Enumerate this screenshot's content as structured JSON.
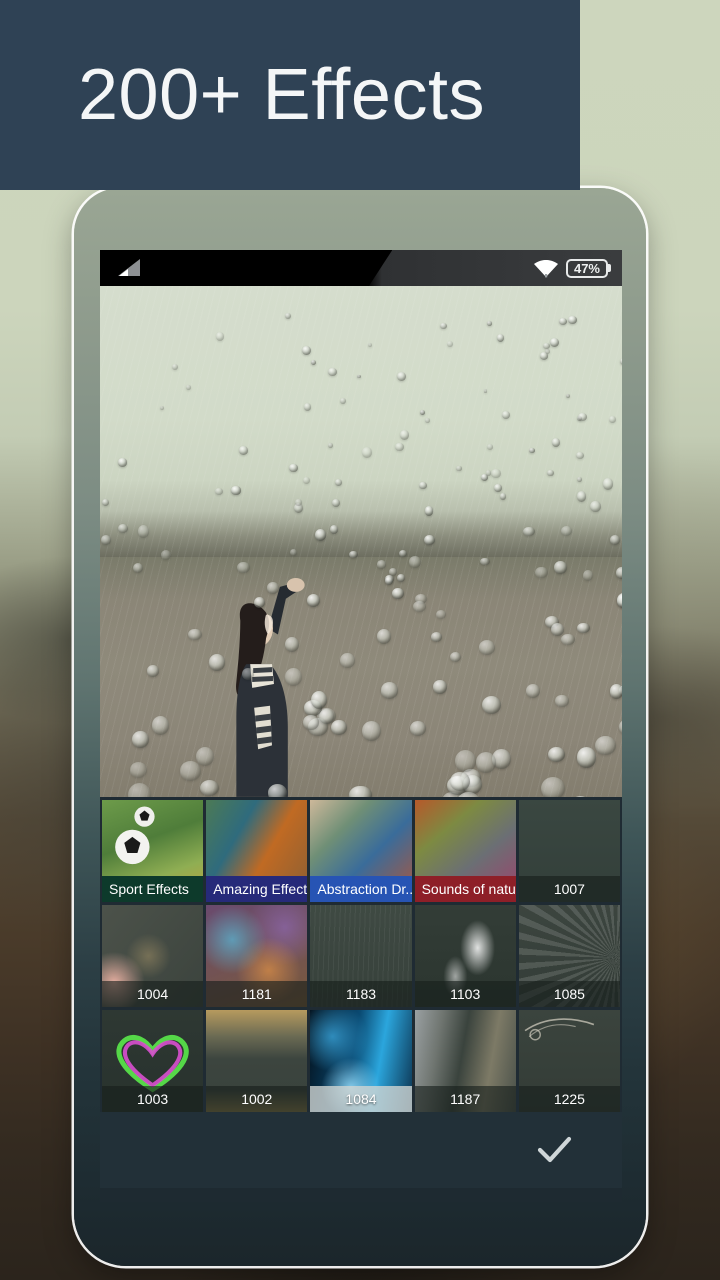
{
  "banner": {
    "title": "200+  Effects",
    "bg_color": "#2f4255",
    "text_color": "#f4f6f7"
  },
  "statusbar": {
    "signal_icon": "cell-signal-icon",
    "wifi_icon": "wifi-icon",
    "battery_level": "47%",
    "battery_icon": "battery-icon"
  },
  "photo": {
    "description": "Woman in striped scarf standing in a rainy field with water-droplet overlay effect",
    "alt": "edited-photo-preview"
  },
  "grid": {
    "columns": 5,
    "rows": 3,
    "items": [
      {
        "label": "Sport Effects",
        "type": "pack",
        "cap_color": "#0d3a2b",
        "selected": false
      },
      {
        "label": "Amazing Effects",
        "type": "pack",
        "cap_color": "#262a7a",
        "selected": false
      },
      {
        "label": "Abstraction Dr...",
        "type": "pack",
        "cap_color": "#2754b4",
        "selected": false
      },
      {
        "label": "Sounds of natu...",
        "type": "pack",
        "cap_color": "#8e1f28",
        "selected": false
      },
      {
        "label": "1007",
        "type": "effect",
        "cap_color": "",
        "selected": false
      },
      {
        "label": "1004",
        "type": "effect",
        "cap_color": "",
        "selected": false
      },
      {
        "label": "1181",
        "type": "effect",
        "cap_color": "",
        "selected": false
      },
      {
        "label": "1183",
        "type": "effect",
        "cap_color": "",
        "selected": false
      },
      {
        "label": "1103",
        "type": "effect",
        "cap_color": "",
        "selected": false
      },
      {
        "label": "1085",
        "type": "effect",
        "cap_color": "",
        "selected": false
      },
      {
        "label": "1003",
        "type": "effect",
        "cap_color": "",
        "selected": false
      },
      {
        "label": "1002",
        "type": "effect",
        "cap_color": "",
        "selected": false
      },
      {
        "label": "1084",
        "type": "effect",
        "cap_color": "",
        "selected": true
      },
      {
        "label": "1187",
        "type": "effect",
        "cap_color": "",
        "selected": false
      },
      {
        "label": "1225",
        "type": "effect",
        "cap_color": "",
        "selected": false
      }
    ]
  },
  "actionbar": {
    "confirm_icon": "checkmark-icon",
    "bg_color": "#223038"
  }
}
